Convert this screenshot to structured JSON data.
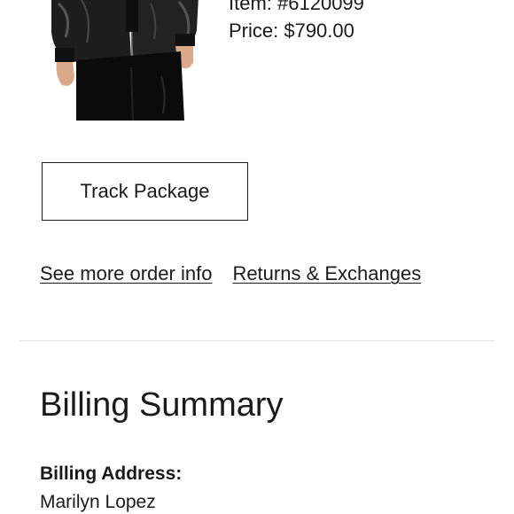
{
  "product": {
    "item_label": "Item: #6120099",
    "price_label": "Price: $790.00"
  },
  "actions": {
    "track_package_label": "Track Package"
  },
  "links": {
    "more_order_info": "See more order info",
    "returns_exchanges": "Returns & Exchanges"
  },
  "billing": {
    "title": "Billing Summary",
    "address_label": "Billing Address:",
    "name": "Marilyn Lopez"
  },
  "colors": {
    "text": "#1a1a1a",
    "divider": "#e2e2e2",
    "background": "#ffffff"
  }
}
